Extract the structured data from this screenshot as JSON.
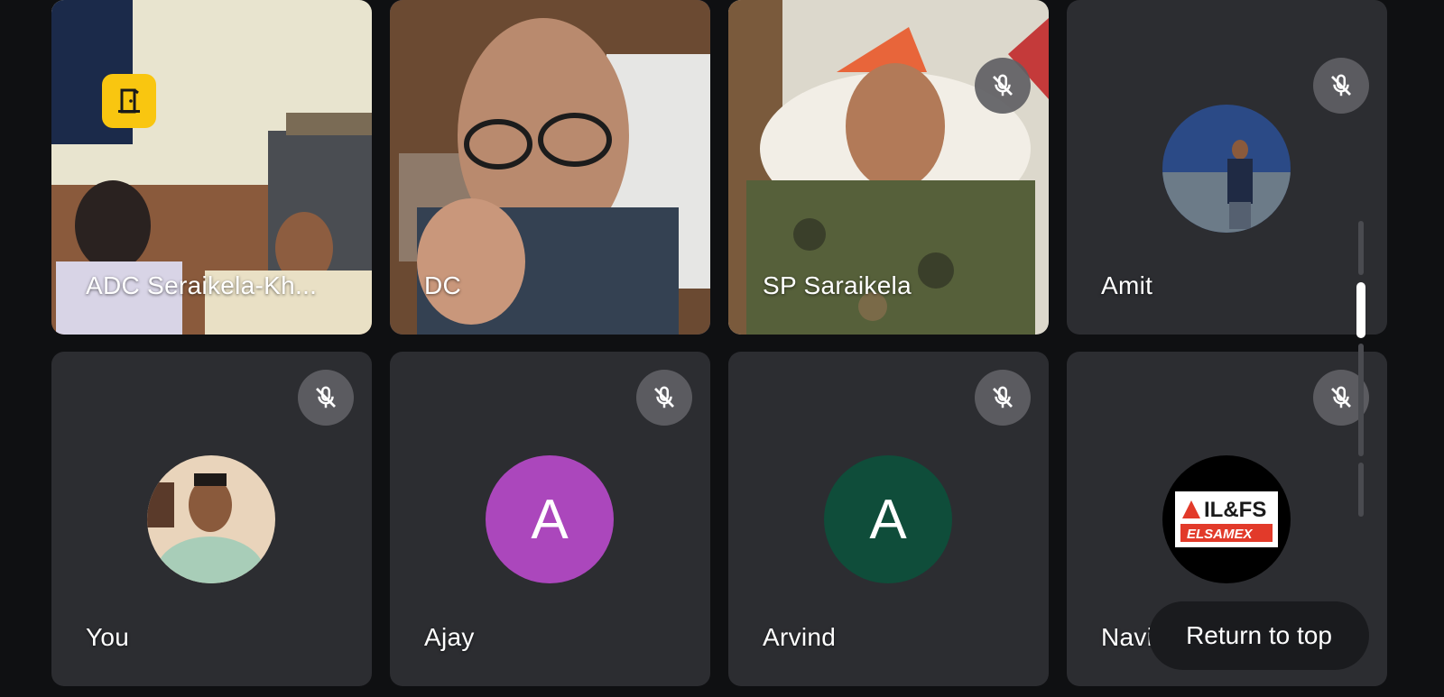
{
  "participants": [
    {
      "name": "ADC Seraikela-Kh...",
      "type": "video",
      "host": true
    },
    {
      "name": "DC",
      "type": "video",
      "speaking": true
    },
    {
      "name": "SP Saraikela",
      "type": "video",
      "muted": true
    },
    {
      "name": "Amit",
      "type": "photo",
      "muted": true
    },
    {
      "name": "You",
      "type": "photo",
      "muted": true
    },
    {
      "name": "Ajay",
      "type": "letter",
      "letter": "A",
      "avatar_color": "#ab47bc",
      "muted": true
    },
    {
      "name": "Arvind",
      "type": "letter",
      "letter": "A",
      "avatar_color": "#0f4d3a",
      "muted": true
    },
    {
      "name": "Navin",
      "type": "logo",
      "muted": true,
      "logo_text_top": "IL&FS",
      "logo_text_bottom": "ELSAMEX"
    }
  ],
  "return_to_top_label": "Return to top",
  "icons": {
    "mic_off": "mic-off-icon",
    "host": "door-icon"
  },
  "colors": {
    "background": "#0f1012",
    "tile": "#2c2d31",
    "active_border": "#2f4d87",
    "host_badge": "#f9c610"
  }
}
